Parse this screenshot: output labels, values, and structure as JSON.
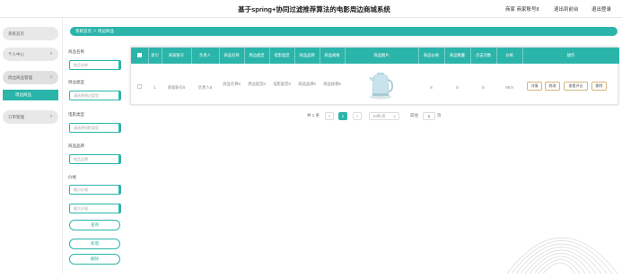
{
  "header": {
    "title": "基于spring+协同过滤推荐算法的电影周边商城系统",
    "user": "商家 商家账号8",
    "links": [
      "退出到前台",
      "退出登录"
    ]
  },
  "sidebar": {
    "items": [
      {
        "label": "系统首页"
      },
      {
        "label": "个人中心",
        "chevron": "∨"
      },
      {
        "label": "周边商品管理",
        "chevron": "∧"
      },
      {
        "label": "订单管理",
        "chevron": "∨"
      }
    ],
    "submenu": [
      {
        "label": "周边商品"
      }
    ]
  },
  "breadcrumb": "系统首页 ＞ 周边商品",
  "filters": {
    "name": {
      "label": "商品名称",
      "placeholder": "商品名称"
    },
    "type": {
      "label": "周边类型",
      "placeholder": "请选择周边类型"
    },
    "movie_type": {
      "label": "电影类型",
      "placeholder": "请选择电影类型"
    },
    "brand": {
      "label": "商品品牌",
      "placeholder": "商品品牌"
    },
    "price": {
      "label": "价格",
      "min_placeholder": "最小价格",
      "max_placeholder": "最大价格"
    },
    "buttons": [
      "查询",
      "新增",
      "删除"
    ]
  },
  "table": {
    "headers": [
      "索引",
      "商家账号",
      "负责人",
      "商品名称",
      "周边类型",
      "电影类型",
      "商品品牌",
      "商品规格",
      "商品图片",
      "商品价格",
      "商品数量",
      "点击次数",
      "价格",
      "操作"
    ],
    "row": {
      "index": "1",
      "merchant": "商家账号8",
      "owner": "负责人8",
      "name": "商品名称8",
      "type": "周边类型8",
      "movie_type": "电影类型8",
      "brand": "商品品牌8",
      "spec": "商品规格8",
      "image_icon": "kettle-product-image",
      "price": "8",
      "quantity": "8",
      "clicks": "8",
      "price2": "99.9",
      "actions": [
        "详情",
        "修改",
        "查看评论",
        "删除"
      ]
    }
  },
  "pagination": {
    "total": "共 1 条",
    "prev": "<",
    "current": "1",
    "next": ">",
    "page_size": "10条/页",
    "goto_label": "前往",
    "goto_value": "1",
    "page_suffix": "页"
  },
  "colors": {
    "accent": "#2bb5aa",
    "action_border": "#d6b47a"
  }
}
